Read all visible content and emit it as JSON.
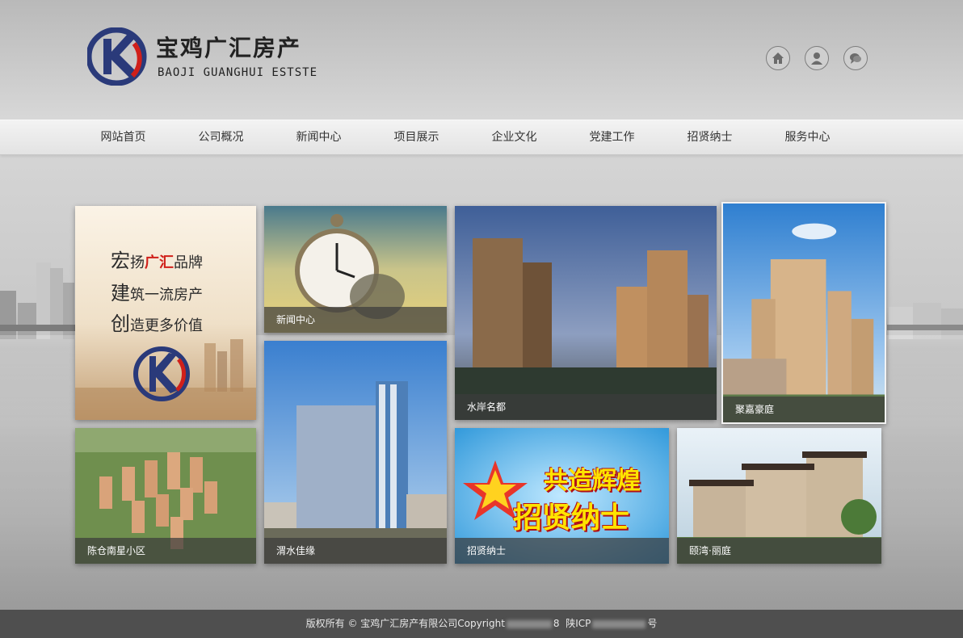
{
  "brand": {
    "name_cn": "宝鸡广汇房产",
    "name_en": "BAOJI GUANGHUI ESTSTE",
    "logo_colors": {
      "blue": "#2a3a7a",
      "red": "#d0201a"
    }
  },
  "header_icons": [
    "home-icon",
    "user-icon",
    "chat-icon"
  ],
  "nav": {
    "items": [
      "网站首页",
      "公司概况",
      "新闻中心",
      "项目展示",
      "企业文化",
      "党建工作",
      "招贤纳士",
      "服务中心"
    ]
  },
  "tiles": {
    "brand_card": {
      "line1": [
        "宏",
        "扬",
        "广汇",
        "品牌"
      ],
      "line2": [
        "建",
        "筑一流房产"
      ],
      "line3": [
        "创",
        "造更多价值"
      ]
    },
    "news": {
      "caption": "新闻中心"
    },
    "waterfront": {
      "caption": "水岸名都"
    },
    "jujia": {
      "caption": "聚嘉豪庭"
    },
    "chenhe": {
      "caption": "陈仓南星小区"
    },
    "weishui": {
      "caption": "渭水佳缘"
    },
    "recruit": {
      "caption": "招贤纳士",
      "slogan1": "共造辉煌",
      "slogan2": "招贤纳士"
    },
    "liting": {
      "caption": "颐湾·丽庭"
    }
  },
  "footer": {
    "prefix": "版权所有 © 宝鸡广汇房产有限公司Copyright",
    "mid": "8",
    "icp": "陕ICP",
    "suffix": "号"
  }
}
